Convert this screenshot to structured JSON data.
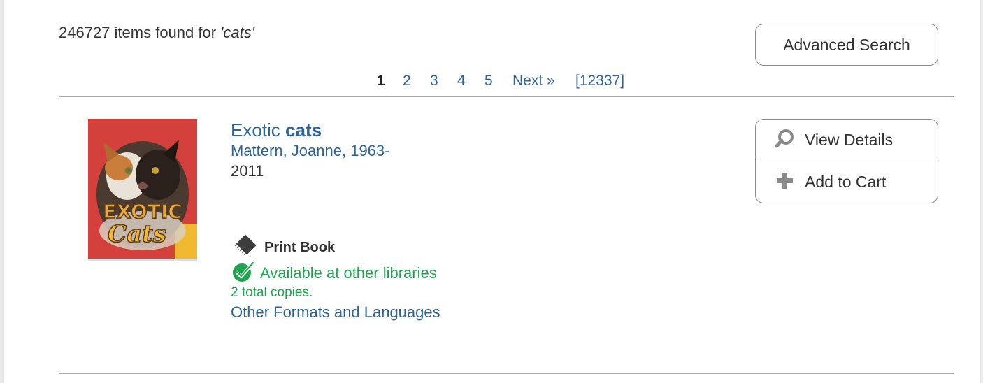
{
  "results": {
    "count": "246727",
    "found_text": " items found for ",
    "query": "'cats'"
  },
  "advanced_search_label": "Advanced Search",
  "pagination": {
    "current": "1",
    "pages": [
      "2",
      "3",
      "4",
      "5"
    ],
    "next_label": "Next »",
    "last_page": "[12337]"
  },
  "item": {
    "cover_art": "Exotic Cats book cover",
    "cover_text": {
      "line1": "EXOTIC",
      "line2": "Cats"
    },
    "title_plain": "Exotic ",
    "title_bold": "cats",
    "author": "Mattern, Joanne, 1963-",
    "year": "2011",
    "format": {
      "icon": "print-book-icon",
      "label": "Print Book"
    },
    "availability": {
      "icon": "check-circle-icon",
      "text": "Available at other libraries",
      "copies": "2 total copies."
    },
    "other_formats_label": "Other Formats and Languages"
  },
  "actions": {
    "view_details": {
      "icon": "view-details-icon",
      "label": "View Details"
    },
    "add_to_cart": {
      "icon": "plus-icon",
      "label": "Add to Cart"
    }
  },
  "colors": {
    "link": "#2f6496",
    "available": "#1ea550",
    "text": "#333333",
    "border": "#8c8c8c",
    "divider": "#a8a8a8",
    "cover_red": "#d4403b"
  }
}
